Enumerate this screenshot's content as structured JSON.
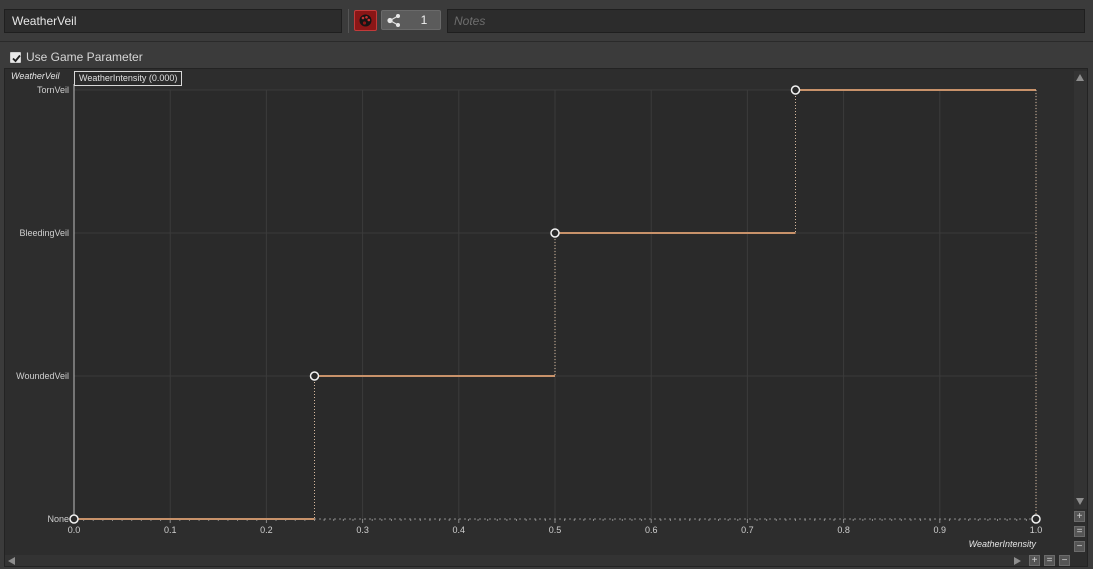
{
  "header": {
    "name_value": "WeatherVeil",
    "color_icon": "palette-icon",
    "color_hex": "#8a1616",
    "share_icon": "share-nodes-icon",
    "share_count": "1",
    "notes_placeholder": "Notes"
  },
  "options": {
    "use_game_parameter_label": "Use Game Parameter",
    "use_game_parameter_checked": true
  },
  "tooltip": {
    "text": "WeatherIntensity (0.000)"
  },
  "chart_data": {
    "type": "line",
    "interpolation": "step",
    "y_axis_label": "WeatherVeil",
    "x_axis_label": "WeatherIntensity",
    "y_categories": [
      "None",
      "WoundedVeil",
      "BleedingVeil",
      "TornVeil"
    ],
    "x_ticks": [
      "0.0",
      "0.1",
      "0.2",
      "0.3",
      "0.4",
      "0.5",
      "0.6",
      "0.7",
      "0.8",
      "0.9",
      "1.0"
    ],
    "xlim": [
      0,
      1
    ],
    "points": [
      {
        "x": 0.0,
        "y": "None"
      },
      {
        "x": 0.25,
        "y": "WoundedVeil"
      },
      {
        "x": 0.5,
        "y": "BleedingVeil"
      },
      {
        "x": 0.75,
        "y": "TornVeil"
      },
      {
        "x": 1.0,
        "y": "None"
      }
    ],
    "line_color": "#c8926a",
    "grid": true
  },
  "controls": {
    "scroll_up_icon": "scroll-up-icon",
    "scroll_down_icon": "scroll-down-icon",
    "scroll_left_icon": "scroll-left-icon",
    "scroll_right_icon": "scroll-right-icon",
    "zoom_in_label": "+",
    "zoom_fit_label": "=",
    "zoom_out_label": "−"
  }
}
